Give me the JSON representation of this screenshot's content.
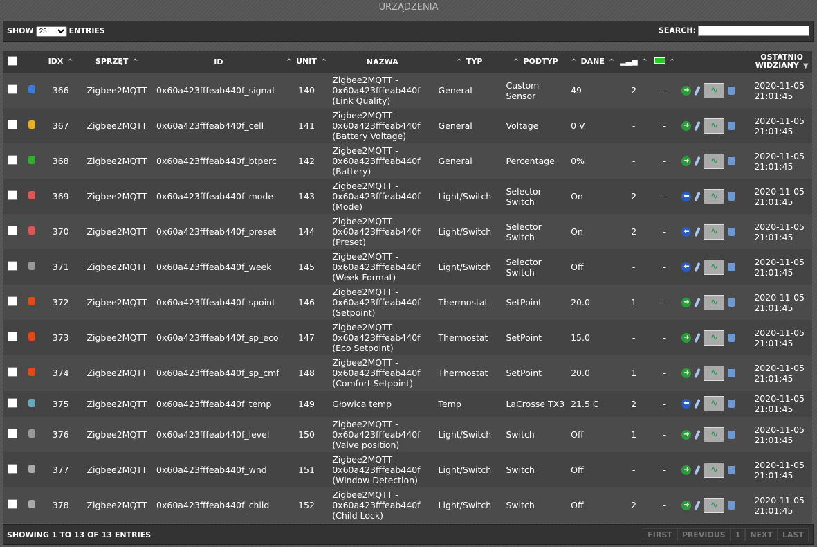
{
  "title": "URZĄDZENIA",
  "controls": {
    "show": "SHOW",
    "entries": "ENTRIES",
    "page_size": "25",
    "search": "SEARCH:",
    "search_value": ""
  },
  "headers": {
    "idx": "IDX",
    "sprzet": "SPRZĘT",
    "id": "ID",
    "unit": "UNIT",
    "nazwa": "NAZWA",
    "typ": "TYP",
    "podtyp": "PODTYP",
    "dane": "DANE",
    "last_seen": "OSTATNIO WIDZIANY"
  },
  "rows": [
    {
      "icon": "globe",
      "icolor": "#3a7bd5",
      "idx": "366",
      "hw": "Zigbee2MQTT",
      "id": "0x60a423fffeab440f_signal",
      "unit": "140",
      "name": "Zigbee2MQTT - 0x60a423fffeab440f (Link Quality)",
      "typ": "General",
      "podtyp": "Custom Sensor",
      "dane": "49",
      "sig": "2",
      "bat": "-",
      "dir": "green",
      "seen": "2020-11-05 21:01:45"
    },
    {
      "icon": "bolt",
      "icolor": "#e8b020",
      "idx": "367",
      "hw": "Zigbee2MQTT",
      "id": "0x60a423fffeab440f_cell",
      "unit": "141",
      "name": "Zigbee2MQTT - 0x60a423fffeab440f (Battery Voltage)",
      "typ": "General",
      "podtyp": "Voltage",
      "dane": "0 V",
      "sig": "-",
      "bat": "-",
      "dir": "green",
      "seen": "2020-11-05 21:01:45"
    },
    {
      "icon": "battery",
      "icolor": "#3a3",
      "idx": "368",
      "hw": "Zigbee2MQTT",
      "id": "0x60a423fffeab440f_btperc",
      "unit": "142",
      "name": "Zigbee2MQTT - 0x60a423fffeab440f (Battery)",
      "typ": "General",
      "podtyp": "Percentage",
      "dane": "0%",
      "sig": "-",
      "bat": "-",
      "dir": "green",
      "seen": "2020-11-05 21:01:45"
    },
    {
      "icon": "heater",
      "icolor": "#d55",
      "idx": "369",
      "hw": "Zigbee2MQTT",
      "id": "0x60a423fffeab440f_mode",
      "unit": "143",
      "name": "Zigbee2MQTT - 0x60a423fffeab440f (Mode)",
      "typ": "Light/Switch",
      "podtyp": "Selector Switch",
      "dane": "On",
      "sig": "2",
      "bat": "-",
      "dir": "blue",
      "seen": "2020-11-05 21:01:45"
    },
    {
      "icon": "heater",
      "icolor": "#d55",
      "idx": "370",
      "hw": "Zigbee2MQTT",
      "id": "0x60a423fffeab440f_preset",
      "unit": "144",
      "name": "Zigbee2MQTT - 0x60a423fffeab440f (Preset)",
      "typ": "Light/Switch",
      "podtyp": "Selector Switch",
      "dane": "On",
      "sig": "2",
      "bat": "-",
      "dir": "blue",
      "seen": "2020-11-05 21:01:45"
    },
    {
      "icon": "generic",
      "icolor": "#999",
      "idx": "371",
      "hw": "Zigbee2MQTT",
      "id": "0x60a423fffeab440f_week",
      "unit": "145",
      "name": "Zigbee2MQTT - 0x60a423fffeab440f (Week Format)",
      "typ": "Light/Switch",
      "podtyp": "Selector Switch",
      "dane": "Off",
      "sig": "-",
      "bat": "-",
      "dir": "blue",
      "seen": "2020-11-05 21:01:45"
    },
    {
      "icon": "flame",
      "icolor": "#e04a1a",
      "idx": "372",
      "hw": "Zigbee2MQTT",
      "id": "0x60a423fffeab440f_spoint",
      "unit": "146",
      "name": "Zigbee2MQTT - 0x60a423fffeab440f (Setpoint)",
      "typ": "Thermostat",
      "podtyp": "SetPoint",
      "dane": "20.0",
      "sig": "1",
      "bat": "-",
      "dir": "green",
      "seen": "2020-11-05 21:01:45"
    },
    {
      "icon": "flame",
      "icolor": "#e04a1a",
      "idx": "373",
      "hw": "Zigbee2MQTT",
      "id": "0x60a423fffeab440f_sp_eco",
      "unit": "147",
      "name": "Zigbee2MQTT - 0x60a423fffeab440f (Eco Setpoint)",
      "typ": "Thermostat",
      "podtyp": "SetPoint",
      "dane": "15.0",
      "sig": "-",
      "bat": "-",
      "dir": "green",
      "seen": "2020-11-05 21:01:45"
    },
    {
      "icon": "flame",
      "icolor": "#e04a1a",
      "idx": "374",
      "hw": "Zigbee2MQTT",
      "id": "0x60a423fffeab440f_sp_cmf",
      "unit": "148",
      "name": "Zigbee2MQTT - 0x60a423fffeab440f (Comfort Setpoint)",
      "typ": "Thermostat",
      "podtyp": "SetPoint",
      "dane": "20.0",
      "sig": "1",
      "bat": "-",
      "dir": "green",
      "seen": "2020-11-05 21:01:45"
    },
    {
      "icon": "thermometer",
      "icolor": "#6ab",
      "idx": "375",
      "hw": "Zigbee2MQTT",
      "id": "0x60a423fffeab440f_temp",
      "unit": "149",
      "name": "Głowica temp",
      "typ": "Temp",
      "podtyp": "LaCrosse TX3",
      "dane": "21.5 C",
      "sig": "2",
      "bat": "-",
      "dir": "blue",
      "seen": "2020-11-05 21:01:45"
    },
    {
      "icon": "generic",
      "icolor": "#999",
      "idx": "376",
      "hw": "Zigbee2MQTT",
      "id": "0x60a423fffeab440f_level",
      "unit": "150",
      "name": "Zigbee2MQTT - 0x60a423fffeab440f (Valve position)",
      "typ": "Light/Switch",
      "podtyp": "Switch",
      "dane": "Off",
      "sig": "1",
      "bat": "-",
      "dir": "green",
      "seen": "2020-11-05 21:01:45"
    },
    {
      "icon": "switch",
      "icolor": "#aaa",
      "idx": "377",
      "hw": "Zigbee2MQTT",
      "id": "0x60a423fffeab440f_wnd",
      "unit": "151",
      "name": "Zigbee2MQTT - 0x60a423fffeab440f (Window Detection)",
      "typ": "Light/Switch",
      "podtyp": "Switch",
      "dane": "Off",
      "sig": "-",
      "bat": "-",
      "dir": "green",
      "seen": "2020-11-05 21:01:45"
    },
    {
      "icon": "switch",
      "icolor": "#aaa",
      "idx": "378",
      "hw": "Zigbee2MQTT",
      "id": "0x60a423fffeab440f_child",
      "unit": "152",
      "name": "Zigbee2MQTT - 0x60a423fffeab440f (Child Lock)",
      "typ": "Light/Switch",
      "podtyp": "Switch",
      "dane": "Off",
      "sig": "2",
      "bat": "-",
      "dir": "green",
      "seen": "2020-11-05 21:01:45"
    }
  ],
  "footer": {
    "info": "SHOWING 1 TO 13 OF 13 ENTRIES",
    "first": "FIRST",
    "previous": "PREVIOUS",
    "page": "1",
    "next": "NEXT",
    "last": "LAST"
  }
}
